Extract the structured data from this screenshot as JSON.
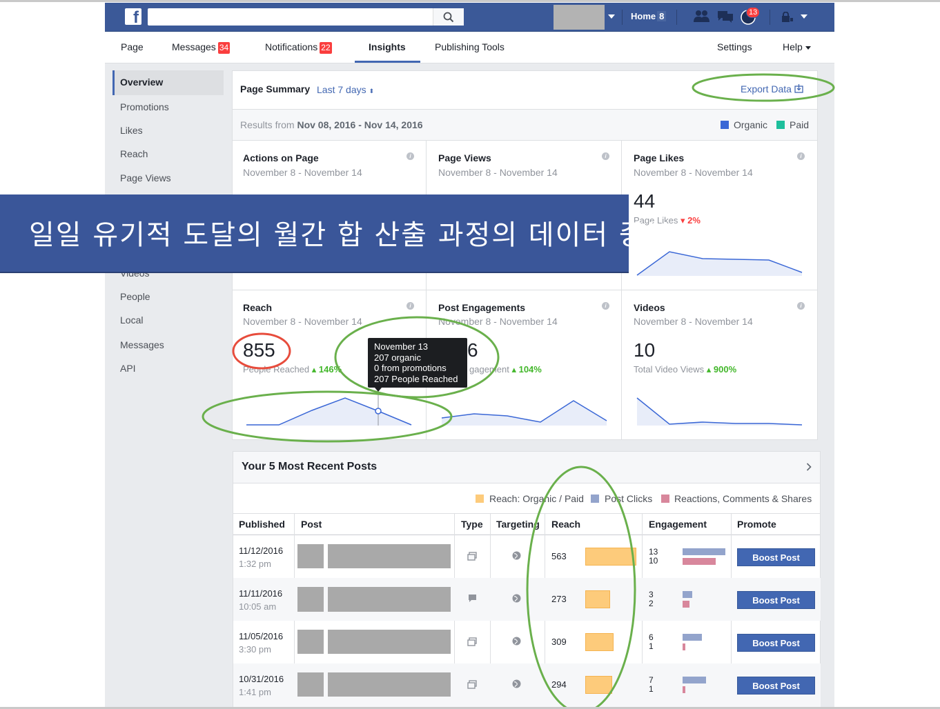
{
  "topbar": {
    "home_label": "Home",
    "home_count": "8",
    "notif_badge": "13"
  },
  "page_nav": {
    "page": "Page",
    "messages": "Messages",
    "messages_count": "34",
    "notifications": "Notifications",
    "notifications_count": "22",
    "insights": "Insights",
    "publishing_tools": "Publishing Tools",
    "settings": "Settings",
    "help": "Help"
  },
  "sidebar": {
    "items": [
      "Overview",
      "Promotions",
      "Likes",
      "Reach",
      "Page Views",
      "Videos",
      "People",
      "Local",
      "Messages",
      "API"
    ]
  },
  "summary": {
    "title": "Page Summary",
    "range": "Last 7 days",
    "export": "Export Data",
    "results_prefix": "Results from",
    "results_range": "Nov 08, 2016 - Nov 14, 2016",
    "legend_organic": "Organic",
    "legend_paid": "Paid",
    "colors": {
      "organic": "#3a67d6",
      "paid": "#1dbf9c"
    }
  },
  "cards": {
    "actions": {
      "title": "Actions on Page",
      "date": "November 8 - November 14"
    },
    "page_views": {
      "title": "Page Views",
      "date": "November 8 - November 14"
    },
    "page_likes": {
      "title": "Page Likes",
      "date": "November 8 - November 14",
      "value": "44",
      "sub": "Page Likes",
      "change": "▾ 2%"
    },
    "reach": {
      "title": "Reach",
      "date": "November 8 - November 14",
      "value": "855",
      "sub": "People Reached",
      "change": "▴ 146%"
    },
    "post_engagements": {
      "title": "Post Engagements",
      "date": "November 8 - November 14",
      "value_tail": "6",
      "sub_tail": "gagement",
      "change": "▴ 104%"
    },
    "videos": {
      "title": "Videos",
      "date": "November 8 - November 14",
      "value": "10",
      "sub": "Total Video Views",
      "change": "▴ 900%"
    }
  },
  "tooltip": {
    "line1": "November 13",
    "line2": "207 organic",
    "line3": "0 from promotions",
    "line4": "207 People Reached"
  },
  "banner": {
    "text": "일일 유기적 도달의 월간 합 산출 과정의 데이터 중복 오류"
  },
  "recent_posts": {
    "title": "Your 5 Most Recent Posts",
    "legend_reach": "Reach: Organic / Paid",
    "legend_clicks": "Post Clicks",
    "legend_reactions": "Reactions, Comments & Shares",
    "colors": {
      "reach": "#fdcb7b",
      "clicks": "#93a4cc",
      "reactions": "#d8879c"
    },
    "columns": [
      "Published",
      "Post",
      "Type",
      "Targeting",
      "Reach",
      "Engagement",
      "Promote"
    ],
    "rows": [
      {
        "date": "11/12/2016",
        "time": "1:32 pm",
        "reach": "563",
        "clicks": "13",
        "reactions": "10",
        "promote": "Boost Post"
      },
      {
        "date": "11/11/2016",
        "time": "10:05 am",
        "reach": "273",
        "clicks": "3",
        "reactions": "2",
        "promote": "Boost Post"
      },
      {
        "date": "11/05/2016",
        "time": "3:30 pm",
        "reach": "309",
        "clicks": "6",
        "reactions": "1",
        "promote": "Boost Post"
      },
      {
        "date": "10/31/2016",
        "time": "1:41 pm",
        "reach": "294",
        "clicks": "7",
        "reactions": "1",
        "promote": "Boost Post"
      }
    ]
  }
}
